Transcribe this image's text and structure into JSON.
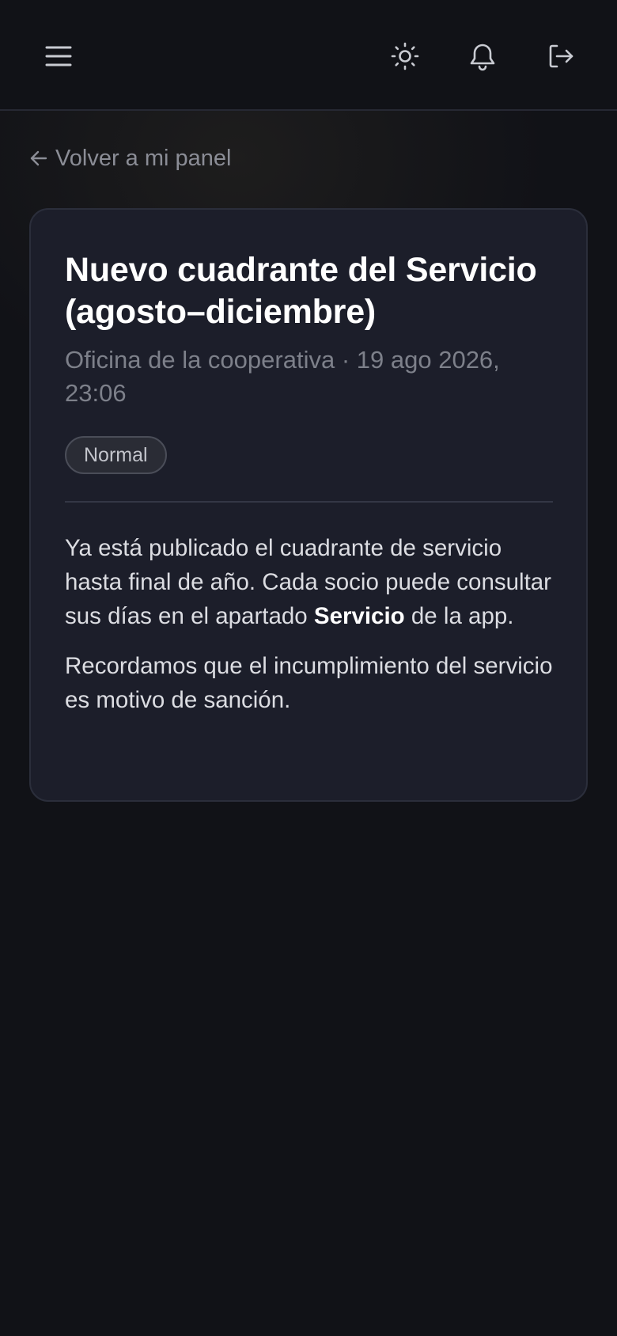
{
  "header": {
    "menu_icon": "menu-icon",
    "theme_icon": "sun-icon",
    "notifications_icon": "bell-icon",
    "logout_icon": "logout-icon"
  },
  "back_link": {
    "label": "Volver a mi panel",
    "icon": "arrow-left-icon"
  },
  "notice": {
    "title": "Nuevo cuadrante del Servicio (agosto–diciembre)",
    "author": "Oficina de la cooperativa",
    "separator": "·",
    "date": "19 ago 2026, 23:06",
    "priority": "Normal",
    "body": {
      "p1_before": "Ya está publicado el cuadrante de servicio hasta final de año. Cada socio puede consultar sus días en el apartado ",
      "p1_bold": "Servicio",
      "p1_after": " de la app.",
      "p2": "Recordamos que el incumplimiento del servicio es motivo de sanción."
    }
  },
  "colors": {
    "background": "#111217",
    "card": "#1c1e2a",
    "title": "#ffffff",
    "muted": "#7d808a"
  }
}
